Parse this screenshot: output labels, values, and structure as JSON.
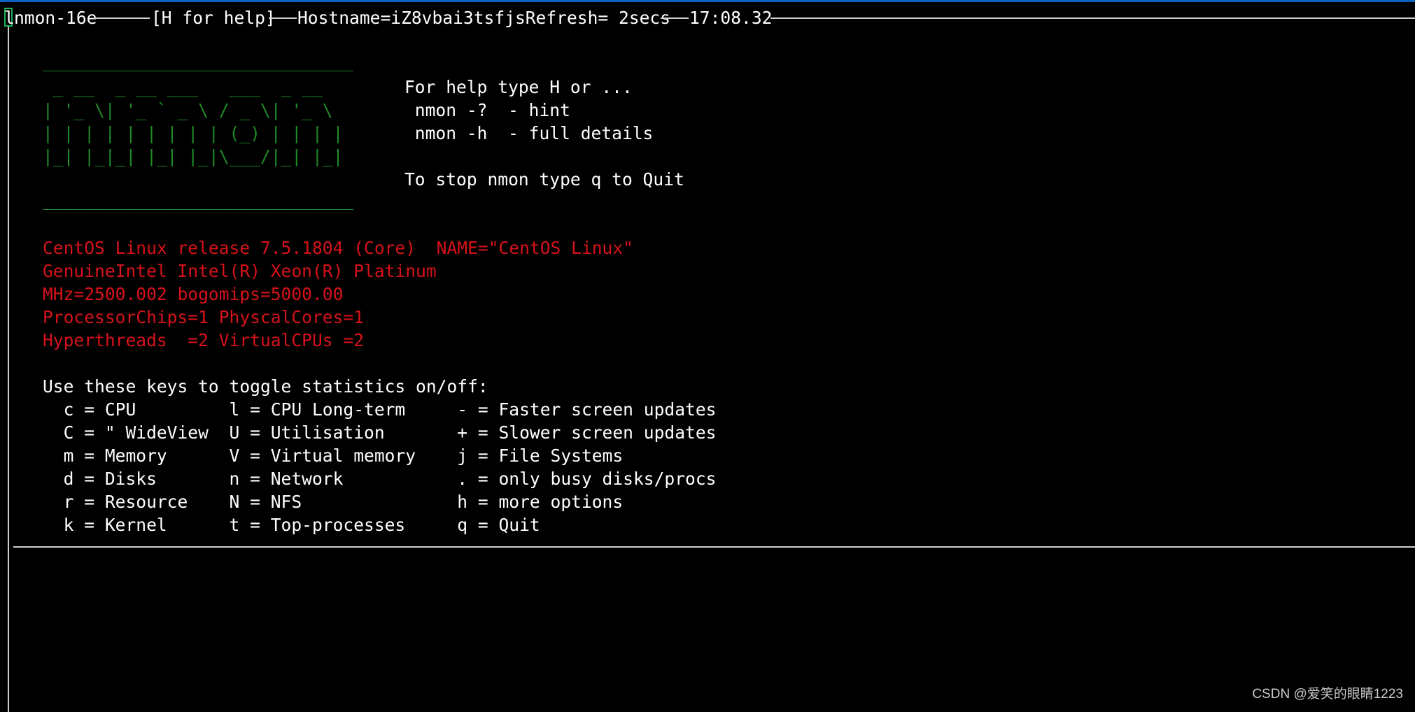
{
  "window": {
    "title_prefix": "l",
    "title_app": "nmon-16e",
    "help_tag": "[H for help]",
    "hostname": "Hostname=iZ8vbai3tsfjsRefresh= 2secs",
    "clock": "17:08.32"
  },
  "logo": {
    "rule_top": "______________________________",
    "art": [
      " _ __  _ __ ___   ___  _ __  ",
      "| '_ \\| '_ ` _ \\ / _ \\| '_ \\ ",
      "| | | | | | | | | (_) | | | |",
      "|_| |_|_| |_| |_|\\___/|_| |_|"
    ],
    "rule_bottom": "______________________________"
  },
  "help_block": [
    "For help type H or ...",
    " nmon -?  - hint",
    " nmon -h  - full details",
    "",
    "To stop nmon type q to Quit"
  ],
  "system_info": [
    "CentOS Linux release 7.5.1804 (Core)  NAME=\"CentOS Linux\"",
    "GenuineIntel Intel(R) Xeon(R) Platinum",
    "MHz=2500.002 bogomips=5000.00",
    "ProcessorChips=1 PhyscalCores=1",
    "Hyperthreads  =2 VirtualCPUs =2"
  ],
  "keys": {
    "heading": "Use these keys to toggle statistics on/off:",
    "rows": [
      "  c = CPU         l = CPU Long-term     - = Faster screen updates",
      "  C = \" WideView  U = Utilisation       + = Slower screen updates",
      "  m = Memory      V = Virtual memory    j = File Systems",
      "  d = Disks       n = Network           . = only busy disks/procs",
      "  r = Resource    N = NFS               h = more options",
      "  k = Kernel      t = Top-processes     q = Quit"
    ]
  },
  "watermark": "CSDN @爱笑的眼睛1223",
  "colors": {
    "background": "#000000",
    "text": "#ffffff",
    "logo_green": "#1f8a26",
    "info_red": "#d6121a",
    "accent_blue": "#0a62c2"
  }
}
